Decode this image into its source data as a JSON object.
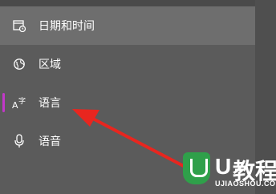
{
  "nav": {
    "items": [
      {
        "label": "日期和时间",
        "icon": "calendar-clock-icon"
      },
      {
        "label": "区域",
        "icon": "globe-icon"
      },
      {
        "label": "语言",
        "icon": "language-icon",
        "selected": true
      },
      {
        "label": "语音",
        "icon": "microphone-icon"
      }
    ]
  },
  "watermark": {
    "brand": "U",
    "cn": "教程",
    "sub": "UJIAOSHOU.COM"
  },
  "colors": {
    "background": "#5b5b5b",
    "selected_indicator": "#c238c9",
    "arrow": "#e8261f",
    "watermark_green": "#2fa04a"
  }
}
